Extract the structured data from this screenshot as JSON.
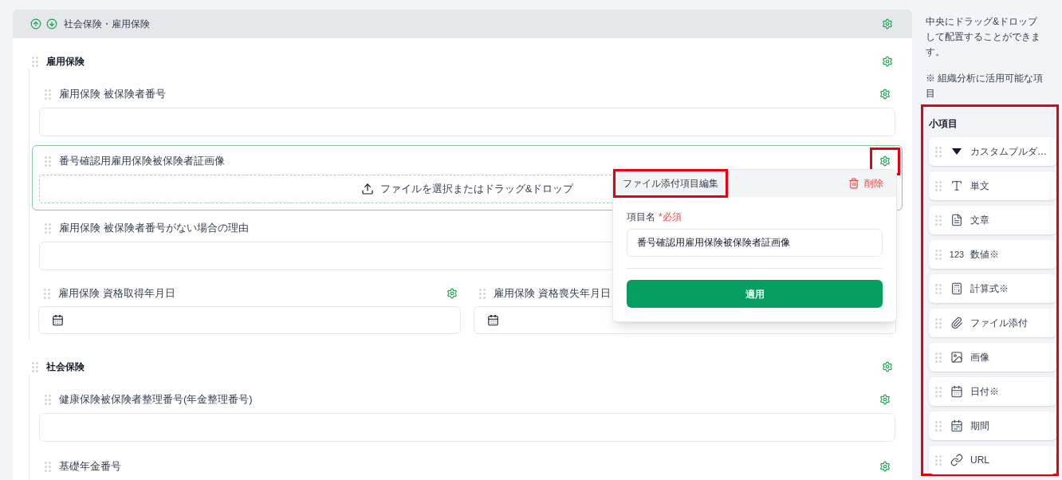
{
  "group": {
    "title": "社会保険・雇用保険",
    "sections": [
      {
        "title": "雇用保険",
        "fields": [
          {
            "kind": "text",
            "label": "雇用保険 被保険者番号",
            "selected": false,
            "settings_icon": true,
            "annotated": false
          },
          {
            "kind": "file",
            "label": "番号確認用雇用保険被保険者証画像",
            "selected": true,
            "settings_icon": true,
            "annotated": true,
            "upload_text": "ファイルを選択またはドラッグ&ドロップ"
          },
          {
            "kind": "text",
            "label": "雇用保険 被保険者番号がない場合の理由",
            "selected": false,
            "settings_icon": false
          },
          {
            "kind": "date_row",
            "columns": [
              {
                "label": "雇用保険 資格取得年月日",
                "settings_icon": true
              },
              {
                "label": "雇用保険 資格喪失年月日",
                "settings_icon": false
              }
            ]
          }
        ]
      },
      {
        "title": "社会保険",
        "fields": [
          {
            "kind": "text",
            "label": "健康保険被保険者整理番号(年金整理番号)",
            "selected": false,
            "settings_icon": true,
            "annotated": false
          },
          {
            "kind": "text",
            "label": "基礎年金番号",
            "selected": false,
            "settings_icon": true,
            "annotated": false
          }
        ]
      }
    ]
  },
  "popover": {
    "title": "ファイル添付項目編集",
    "annotated": true,
    "delete": "削除",
    "field_label": "項目名",
    "required": "*必須",
    "value": "番号確認用雇用保険被保険者証画像",
    "apply": "適用"
  },
  "sidebar": {
    "help": "中央にドラッグ&ドロップして配置することができます。",
    "note": "※ 組織分析に活用可能な項目",
    "heading": "小項目",
    "annotated": true,
    "items": [
      {
        "kind": "dropdown",
        "label": "カスタムプルダ…"
      },
      {
        "kind": "single_line",
        "label": "単文"
      },
      {
        "kind": "paragraph",
        "label": "文章"
      },
      {
        "kind": "number",
        "glyph": "123",
        "label": "数値※"
      },
      {
        "kind": "formula",
        "label": "計算式※"
      },
      {
        "kind": "attachment",
        "label": "ファイル添付"
      },
      {
        "kind": "image",
        "label": "画像"
      },
      {
        "kind": "date",
        "label": "日付※"
      },
      {
        "kind": "period",
        "label": "期間"
      },
      {
        "kind": "url",
        "label": "URL"
      }
    ]
  }
}
